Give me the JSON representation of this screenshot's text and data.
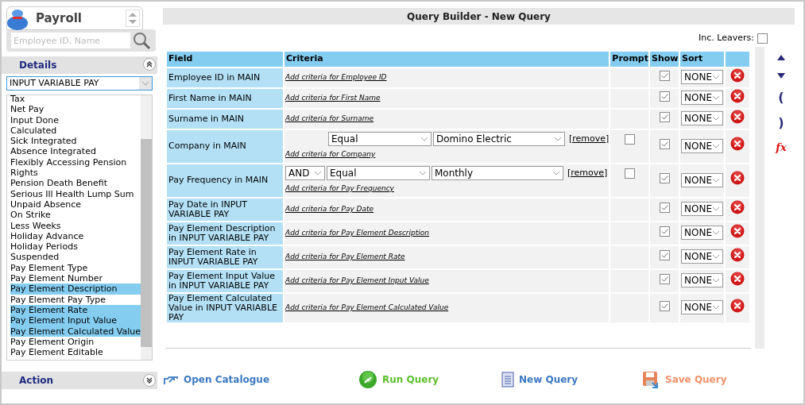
{
  "app": {
    "title": "Payroll",
    "search": {
      "placeholder": "Employee ID, Name"
    }
  },
  "sidebar": {
    "details": {
      "title": "Details",
      "expanded": true
    },
    "table_select": "INPUT VARIABLE PAY",
    "items": [
      {
        "label": "Tax",
        "selected": false
      },
      {
        "label": "Net Pay",
        "selected": false
      },
      {
        "label": "Input Done",
        "selected": false
      },
      {
        "label": "Calculated",
        "selected": false
      },
      {
        "label": "Sick Integrated",
        "selected": false
      },
      {
        "label": "Absence Integrated",
        "selected": false
      },
      {
        "label": "Flexibly Accessing Pension",
        "selected": false
      },
      {
        "label": "Rights",
        "selected": false
      },
      {
        "label": "Pension Death Benefit",
        "selected": false
      },
      {
        "label": "Serious Ill Health Lump Sum",
        "selected": false
      },
      {
        "label": "Unpaid Absence",
        "selected": false
      },
      {
        "label": "On Strike",
        "selected": false
      },
      {
        "label": "Less Weeks",
        "selected": false
      },
      {
        "label": "Holiday Advance",
        "selected": false
      },
      {
        "label": "Holiday Periods",
        "selected": false
      },
      {
        "label": "Suspended",
        "selected": false
      },
      {
        "label": "Pay Element Type",
        "selected": false
      },
      {
        "label": "Pay Element Number",
        "selected": false
      },
      {
        "label": "Pay Element Description",
        "selected": true
      },
      {
        "label": "Pay Element Pay Type",
        "selected": false
      },
      {
        "label": "Pay Element Rate",
        "selected": true
      },
      {
        "label": "Pay Element Input Value",
        "selected": true
      },
      {
        "label": "Pay Element Calculated Value",
        "selected": true
      },
      {
        "label": "Pay Element Origin",
        "selected": false
      },
      {
        "label": "Pay Element Editable",
        "selected": false
      }
    ],
    "action": {
      "title": "Action",
      "expanded": false
    }
  },
  "query": {
    "title": "Query Builder - New Query",
    "inc_leavers": {
      "label": "Inc. Leavers:",
      "checked": false
    },
    "columns": [
      "Field",
      "Criteria",
      "Prompt",
      "Show",
      "Sort"
    ],
    "rows": [
      {
        "field": "Employee ID in MAIN",
        "add_link": "Add criteria for Employee ID",
        "show": true,
        "sort": "NONE"
      },
      {
        "field": "First Name in MAIN",
        "add_link": "Add criteria for First Name",
        "show": true,
        "sort": "NONE"
      },
      {
        "field": "Surname in MAIN",
        "add_link": "Add criteria for Surname",
        "show": true,
        "sort": "NONE"
      },
      {
        "field": "Company in MAIN",
        "conditions": [
          {
            "operator": "Equal",
            "value": "Domino Electric",
            "remove": "[remove]",
            "prompt": false
          }
        ],
        "add_link": "Add criteria for Company",
        "show": true,
        "sort": "NONE"
      },
      {
        "field": "Pay Frequency in MAIN",
        "conditions": [
          {
            "connector": "AND",
            "operator": "Equal",
            "value": "Monthly",
            "remove": "[remove]",
            "prompt": false
          }
        ],
        "add_link": "Add criteria for Pay Frequency",
        "show": true,
        "sort": "NONE"
      },
      {
        "field": "Pay Date in INPUT VARIABLE PAY",
        "add_link": "Add criteria for Pay Date",
        "show": true,
        "sort": "NONE"
      },
      {
        "field": "Pay Element Description in INPUT VARIABLE PAY",
        "add_link": "Add criteria for Pay Element Description",
        "show": true,
        "sort": "NONE"
      },
      {
        "field": "Pay Element Rate in INPUT VARIABLE PAY",
        "add_link": "Add criteria for Pay Element Rate",
        "show": true,
        "sort": "NONE"
      },
      {
        "field": "Pay Element Input Value in INPUT VARIABLE PAY",
        "add_link": "Add criteria for Pay Element Input Value",
        "show": true,
        "sort": "NONE"
      },
      {
        "field": "Pay Element Calculated Value in INPUT VARIABLE PAY",
        "add_link": "Add criteria for Pay Element Calculated Value",
        "show": true,
        "sort": "NONE"
      }
    ],
    "side_tools": [
      {
        "kind": "up"
      },
      {
        "kind": "down"
      },
      {
        "kind": "text",
        "label": "("
      },
      {
        "kind": "text",
        "label": ")"
      },
      {
        "kind": "fx",
        "label": "fx"
      }
    ],
    "actions": [
      {
        "kind": "open",
        "label": "Open Catalogue",
        "color": "#3b78c0"
      },
      {
        "kind": "run",
        "label": "Run Query",
        "color": "#5cbf2a"
      },
      {
        "kind": "new",
        "label": "New Query",
        "color": "#3b78c0"
      },
      {
        "kind": "save",
        "label": "Save Query",
        "color": "#f0906a"
      }
    ]
  }
}
